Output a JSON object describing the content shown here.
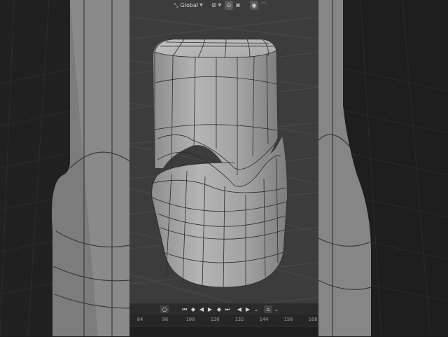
{
  "header": {
    "orientation_label": "Global",
    "icons": [
      "transform-orientation-icon",
      "pivot-icon",
      "snap-icon",
      "proportional-edit-icon",
      "falloff-icon"
    ]
  },
  "timeline": {
    "frames": [
      "84",
      "96",
      "108",
      "120",
      "132",
      "144",
      "156",
      "168"
    ]
  },
  "colors": {
    "viewport_bg": "#3c3c3c",
    "grid_line": "#4b4b4b",
    "mesh_body": "#a6a6a6",
    "wire": "#2b2b2b",
    "panel": "#2b2b2b"
  }
}
